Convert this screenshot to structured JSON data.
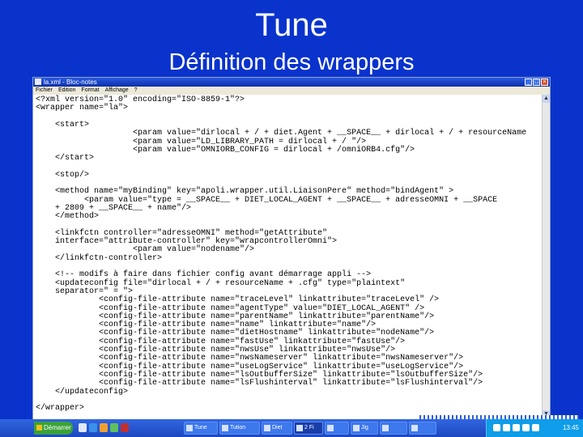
{
  "slide": {
    "title": "Tune",
    "subtitle": "Définition des wrappers"
  },
  "window": {
    "title": "la.xml - Bloc-notes",
    "controls": {
      "minimize": "_",
      "maximize": "□",
      "close": "×"
    },
    "menu": [
      "Fichier",
      "Edition",
      "Format",
      "Affichage",
      "?"
    ]
  },
  "code_lines": [
    "<?xml version=\"1.0\" encoding=\"ISO-8859-1\"?>",
    "<wrapper name=\"la\">",
    "",
    "    <start>",
    "                    <param value=\"dirlocal + / + diet.Agent + __SPACE__ + dirlocal + / + resourceName",
    "                    <param value=\"LD_LIBRARY_PATH = dirlocal + / \"/>",
    "                    <param value=\"OMNIORB_CONFIG = dirlocal + /omniORB4.cfg\"/>",
    "    </start>",
    "",
    "    <stop/>",
    "",
    "    <method name=\"myBinding\" key=\"apoli.wrapper.util.LiaisonPere\" method=\"bindAgent\" >",
    "          <param value=\"type = __SPACE__ + DIET_LOCAL_AGENT + __SPACE__ + adresseOMNI + __SPACE",
    "    + 2809 + __SPACE__ + name\"/>",
    "    </method>",
    "",
    "    <linkfctn controller=\"adresseOMNI\" method=\"getAttribute\"",
    "    interface=\"attribute-controller\" key=\"wrapcontrollerOmni\">",
    "                    <param value=\"nodename\"/>",
    "    </linkfctn-controller>",
    "",
    "    <!-- modifs à faire dans fichier config avant démarrage appli -->",
    "    <updateconfig file=\"dirlocal + / + resourceName + .cfg\" type=\"plaintext\"",
    "    separator=\" = \">",
    "             <config-file-attribute name=\"traceLevel\" linkattribute=\"traceLevel\" />",
    "             <config-file-attribute name=\"agentType\" value=\"DIET_LOCAL_AGENT\" />",
    "             <config-file-attribute name=\"parentName\" linkattribute=\"parentName\"/>",
    "             <config-file-attribute name=\"name\" linkattribute=\"name\"/>",
    "             <config-file-attribute name=\"dietHostname\" linkattribute=\"nodeName\"/>",
    "             <config-file-attribute name=\"fastUse\" linkattribute=\"fastUse\"/>",
    "             <config-file-attribute name=\"nwsUse\" linkattribute=\"nwsUse\"/>",
    "             <config-file-attribute name=\"nwsNameserver\" linkattribute=\"nwsNameserver\"/>",
    "             <config-file-attribute name=\"useLogService\" linkattribute=\"useLogService\"/>",
    "             <config-file-attribute name=\"lsOutbufferSize\" linkattribute=\"lsOutbufferSize\"/>",
    "             <config-file-attribute name=\"lsFlushinterval\" linkattribute=\"lsFlushinterval\"/>",
    "    </updateconfig>",
    "",
    "</wrapper>"
  ],
  "taskbar": {
    "start_label": "Démarrer",
    "tasks": [
      "Tune",
      "Tution",
      "Diet",
      "2 Fi",
      "",
      "Jig",
      "",
      ""
    ],
    "clock": "13:45",
    "colors": {
      "taskbar": "#1c48c0",
      "start": "#3aa23a",
      "tray": "#0f9ce8"
    }
  }
}
